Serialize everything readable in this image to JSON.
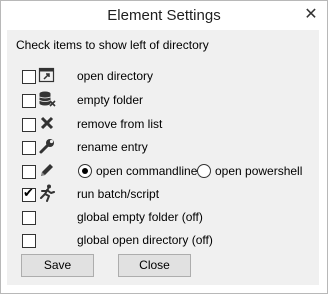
{
  "window": {
    "title": "Element Settings",
    "close_glyph": "✕"
  },
  "heading": "Check items to show left of directory",
  "items": [
    {
      "label": "open directory",
      "checked": false,
      "icon": "open-folder-icon"
    },
    {
      "label": "empty folder",
      "checked": false,
      "icon": "database-x-icon"
    },
    {
      "label": "remove from list",
      "checked": false,
      "icon": "close-x-icon"
    },
    {
      "label": "rename entry",
      "checked": false,
      "icon": "wrench-icon"
    },
    {
      "label": "",
      "checked": false,
      "icon": "pencil-icon"
    },
    {
      "label": "run batch/script",
      "checked": true,
      "icon": "runner-icon"
    },
    {
      "label": "global empty folder (off)",
      "checked": false,
      "icon": ""
    },
    {
      "label": "global open directory (off)",
      "checked": false,
      "icon": ""
    }
  ],
  "radios": {
    "commandline": {
      "label": "open commandline",
      "selected": true
    },
    "powershell": {
      "label": "open powershell",
      "selected": false
    }
  },
  "buttons": {
    "save": "Save",
    "close": "Close"
  },
  "check_glyph": "✔"
}
